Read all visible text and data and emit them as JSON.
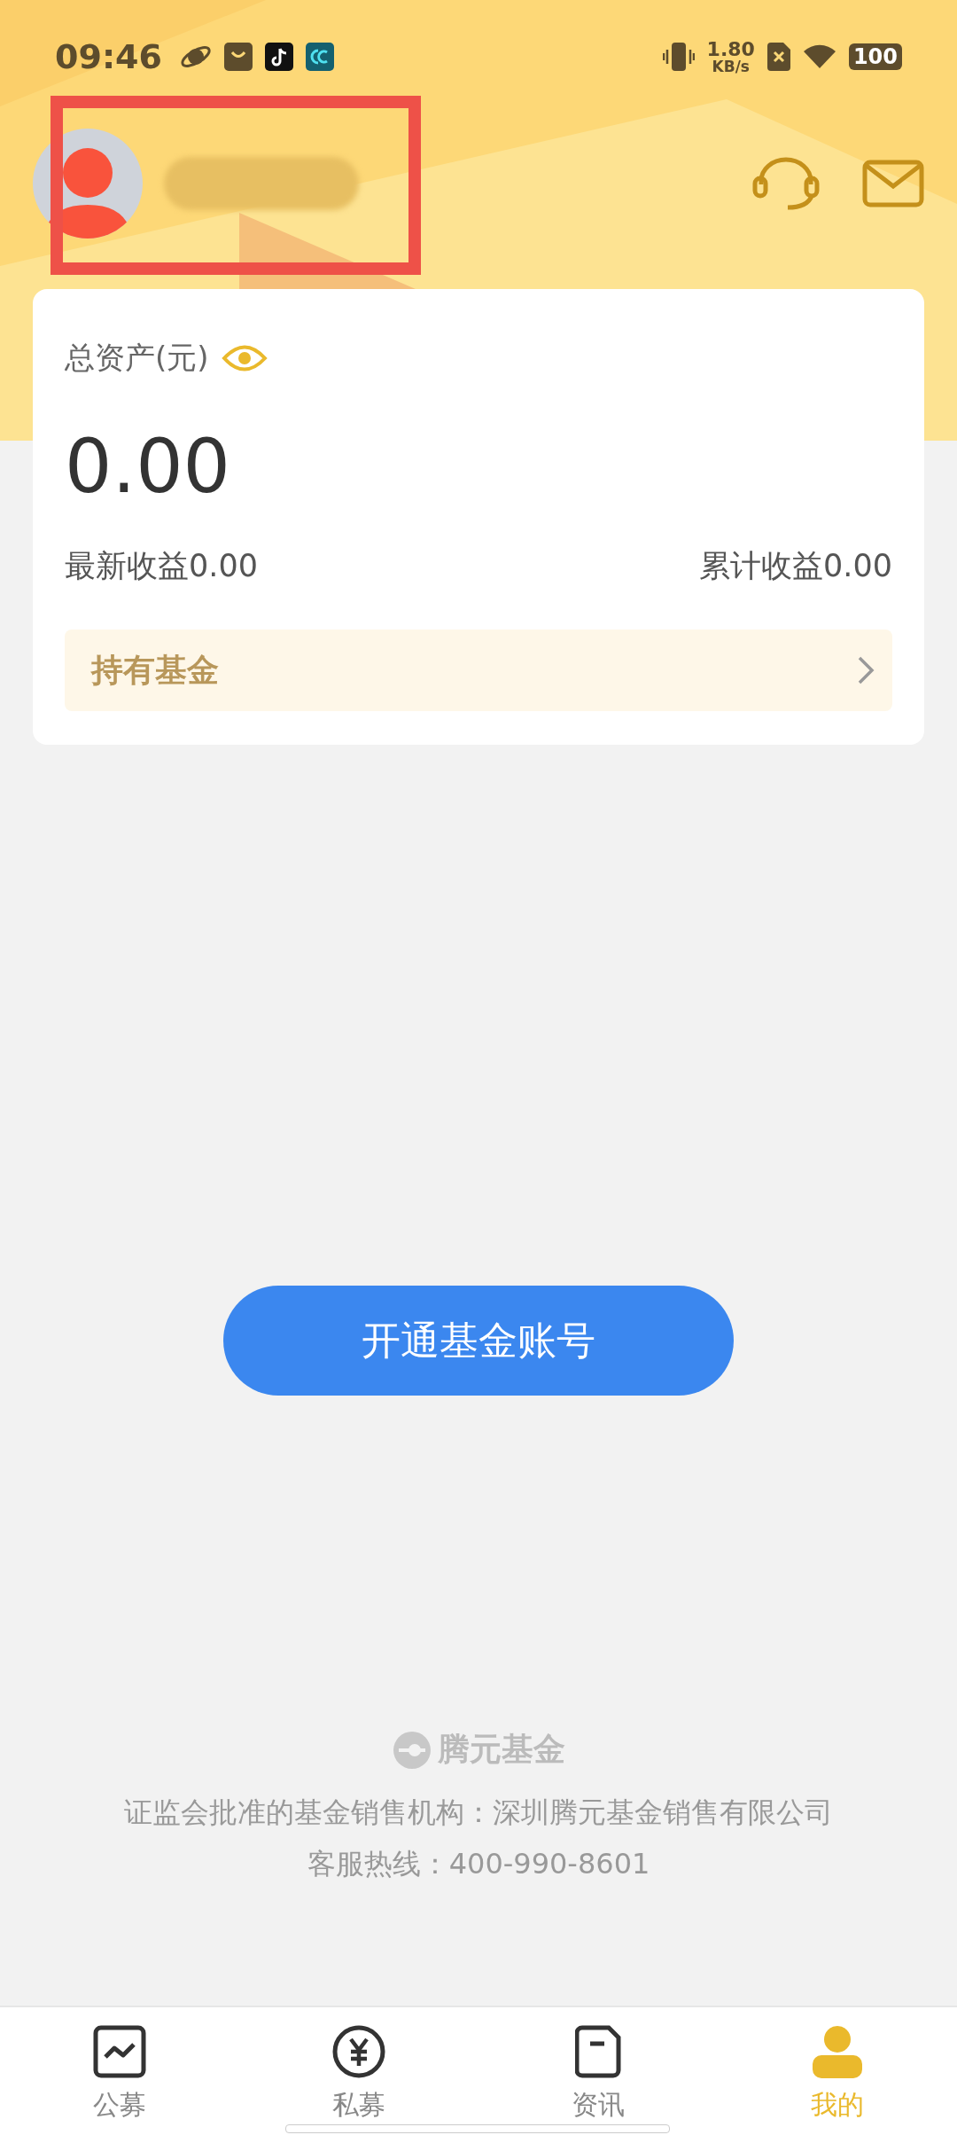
{
  "status_bar": {
    "time": "09:46",
    "net_speed_value": "1.80",
    "net_speed_unit": "KB/s",
    "battery": "100"
  },
  "assets_card": {
    "label": "总资产(元)",
    "amount": "0.00",
    "latest_income": "最新收益0.00",
    "total_income": "累计收益0.00",
    "holdings_link": "持有基金"
  },
  "open_account_button": "开通基金账号",
  "footer": {
    "brand": "腾元基金",
    "license": "证监会批准的基金销售机构：深圳腾元基金销售有限公司",
    "hotline": "客服热线：400-990-8601"
  },
  "tabs": [
    {
      "label": "公募",
      "kind": "chart",
      "selected": false
    },
    {
      "label": "私募",
      "kind": "yen",
      "selected": false
    },
    {
      "label": "资讯",
      "kind": "doc",
      "selected": false
    },
    {
      "label": "我的",
      "kind": "person",
      "selected": true
    }
  ]
}
